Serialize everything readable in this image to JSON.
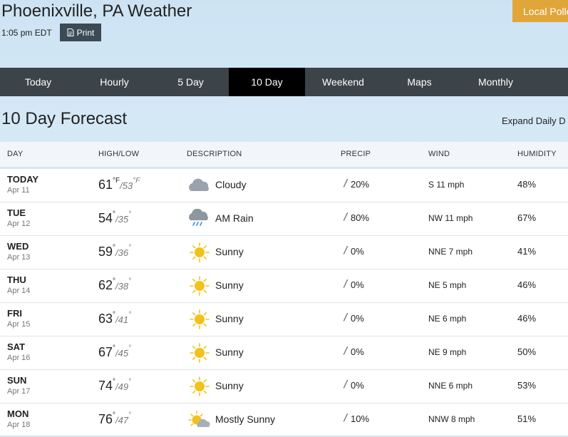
{
  "header": {
    "city_title": "Phoenixville, PA Weather",
    "time": "1:05 pm EDT",
    "print_label": "Print",
    "pollen_label": "Local Polle"
  },
  "nav": {
    "tabs": [
      "Today",
      "Hourly",
      "5 Day",
      "10 Day",
      "Weekend",
      "Maps",
      "Monthly"
    ],
    "active_tab": "10 Day"
  },
  "page_title": "10 Day Forecast",
  "expand_label": "Expand Daily D",
  "table": {
    "columns": [
      "DAY",
      "HIGH/LOW",
      "DESCRIPTION",
      "PRECIP",
      "WIND",
      "HUMIDITY"
    ],
    "rows": [
      {
        "day": "TODAY",
        "date": "Apr 11",
        "high": "61",
        "high_unit": "°F",
        "low": "53",
        "low_unit": "°F",
        "icon": "cloudy-icon",
        "description": "Cloudy",
        "precip": "20%",
        "wind": "S 11 mph",
        "humidity": "48%"
      },
      {
        "day": "TUE",
        "date": "Apr 12",
        "high": "54",
        "high_unit": "°",
        "low": "35",
        "low_unit": "°",
        "icon": "rain-icon",
        "description": "AM Rain",
        "precip": "80%",
        "wind": "NW 11 mph",
        "humidity": "67%"
      },
      {
        "day": "WED",
        "date": "Apr 13",
        "high": "59",
        "high_unit": "°",
        "low": "36",
        "low_unit": "°",
        "icon": "sun-icon",
        "description": "Sunny",
        "precip": "0%",
        "wind": "NNE 7 mph",
        "humidity": "41%"
      },
      {
        "day": "THU",
        "date": "Apr 14",
        "high": "62",
        "high_unit": "°",
        "low": "38",
        "low_unit": "°",
        "icon": "sun-icon",
        "description": "Sunny",
        "precip": "0%",
        "wind": "NE 5 mph",
        "humidity": "46%"
      },
      {
        "day": "FRI",
        "date": "Apr 15",
        "high": "63",
        "high_unit": "°",
        "low": "41",
        "low_unit": "°",
        "icon": "sun-icon",
        "description": "Sunny",
        "precip": "0%",
        "wind": "NE 6 mph",
        "humidity": "46%"
      },
      {
        "day": "SAT",
        "date": "Apr 16",
        "high": "67",
        "high_unit": "°",
        "low": "45",
        "low_unit": "°",
        "icon": "sun-icon",
        "description": "Sunny",
        "precip": "0%",
        "wind": "NE 9 mph",
        "humidity": "50%"
      },
      {
        "day": "SUN",
        "date": "Apr 17",
        "high": "74",
        "high_unit": "°",
        "low": "49",
        "low_unit": "°",
        "icon": "sun-icon",
        "description": "Sunny",
        "precip": "0%",
        "wind": "NNE 6 mph",
        "humidity": "53%"
      },
      {
        "day": "MON",
        "date": "Apr 18",
        "high": "76",
        "high_unit": "°",
        "low": "47",
        "low_unit": "°",
        "icon": "mostly-sunny-icon",
        "description": "Mostly Sunny",
        "precip": "10%",
        "wind": "NNW 8 mph",
        "humidity": "51%"
      }
    ]
  },
  "colors": {
    "nav_bg": "#3c4349",
    "nav_active": "#000000",
    "pollen_btn": "#e0a63a",
    "sun": "#f3c11b",
    "cloud": "#9aa3ab"
  }
}
